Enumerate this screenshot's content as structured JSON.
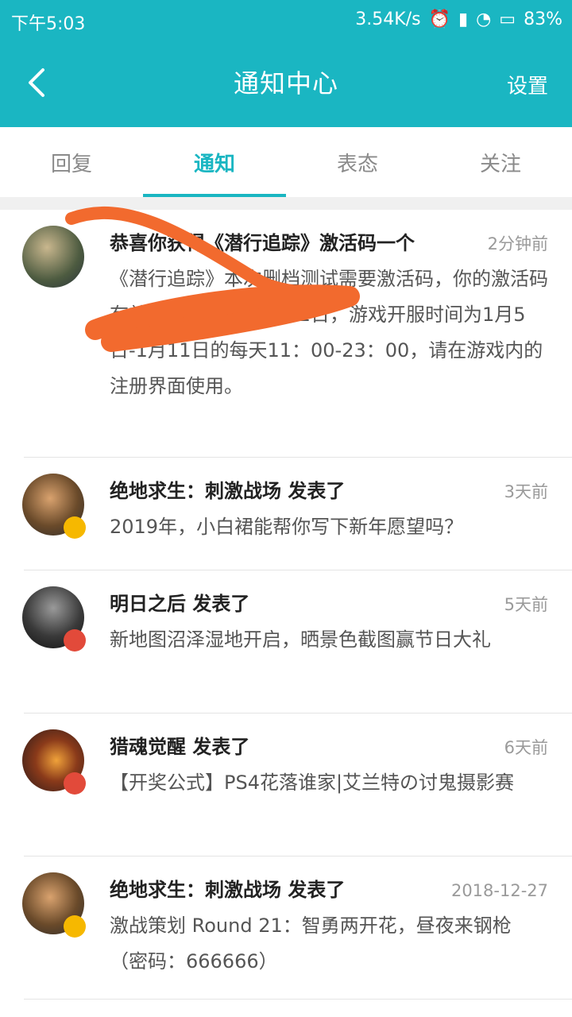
{
  "status_bar": {
    "time": "下午5:03",
    "speed": "3.54K/s",
    "battery": "83%"
  },
  "header": {
    "title": "通知中心",
    "settings_label": "设置"
  },
  "tabs": [
    {
      "label": "回复",
      "active": false
    },
    {
      "label": "通知",
      "active": true
    },
    {
      "label": "表态",
      "active": false
    },
    {
      "label": "关注",
      "active": false
    }
  ],
  "notifications": [
    {
      "title": "恭喜你获得《潜行追踪》激活码一个",
      "time": "2分钟前",
      "body": "《潜行追踪》本次删档测试需要激活码，你的激活码有效期：1月5日-1月12日，游戏开服时间为1月5日-1月11日的每天11：00-23：00，请在游戏内的注册界面使用。"
    },
    {
      "title": "绝地求生：刺激战场 发表了",
      "time": "3天前",
      "body": "2019年，小白裙能帮你写下新年愿望吗？"
    },
    {
      "title": "明日之后 发表了",
      "time": "5天前",
      "body": "新地图沼泽湿地开启，晒景色截图赢节日大礼"
    },
    {
      "title": "猎魂觉醒 发表了",
      "time": "6天前",
      "body": "【开奖公式】PS4花落谁家|艾兰特の讨鬼摄影赛"
    },
    {
      "title": "绝地求生：刺激战场 发表了",
      "time": "2018-12-27",
      "body": "激战策划 Round 21：智勇两开花，昼夜来钢枪（密码：666666）"
    }
  ],
  "colors": {
    "accent": "#1ab6c2",
    "scribble": "#f26a2e"
  }
}
